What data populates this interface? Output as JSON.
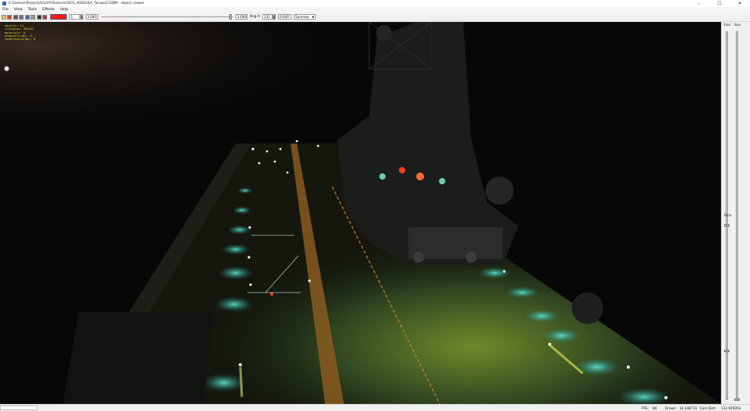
{
  "window": {
    "title": "E:\\Games\\Projects\\ULHA\\Textures\\OCS_ADD\\USA_Tarawa1.DDM - object viewer",
    "controls": [
      "–",
      "☐",
      "✕"
    ]
  },
  "menu": [
    "File",
    "View",
    "Tools",
    "Effects",
    "Help"
  ],
  "toolbar": {
    "swatch_color": "#ff1a1a",
    "field1": "1",
    "field2": "1.000",
    "slider_value": "1.000",
    "angle_label": "Ang X",
    "angle_value": "131",
    "field3": "0.640",
    "season": "Summer"
  },
  "overlay": {
    "lines": [
      "objects: 14",
      "triangles: 981407",
      "materials: 0",
      "drawcalls(dm): 0",
      "lodDistance(dm): 0"
    ]
  },
  "side": {
    "env_label": "Env",
    "sun_label": "Sun",
    "rain_label": "Rain"
  },
  "status": {
    "fps_label": "FPS:",
    "fps_value": "84",
    "drawn_label": "Drawn:",
    "drawn_value": "10.348731",
    "camdist_label": "Cam Dist:",
    "camdist_value": "132.925053"
  },
  "colors": {
    "deck_light": "#3fd0c0",
    "deck_glow": "#7fa83a",
    "stripe": "#c8822a",
    "red_light": "#ff3a1a",
    "overlay_text": "#d8d82a"
  }
}
